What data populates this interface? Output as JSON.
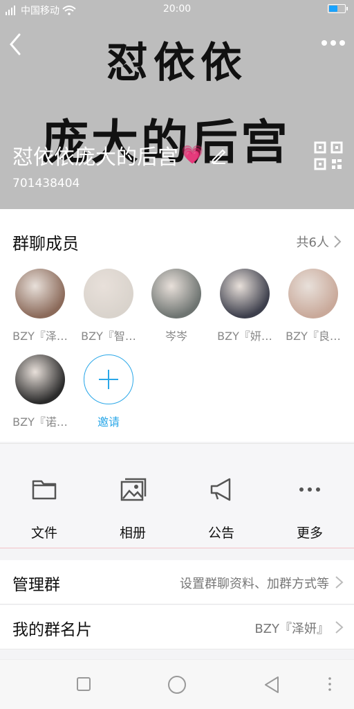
{
  "status_bar": {
    "carrier": "中国移动",
    "time": "20:00",
    "battery_level": 0.5
  },
  "header": {
    "art_line1": "怼依依",
    "art_line2": "庞大的后宫",
    "group_title": "怼依依庞大的后宫",
    "group_id": "701438404"
  },
  "members": {
    "title": "群聊成员",
    "count": "共6人",
    "list": [
      {
        "name": "BZY『泽…",
        "color": "#8b6a5a"
      },
      {
        "name": "BZY『智…",
        "color": "#d9d3cc"
      },
      {
        "name": "岑岑",
        "color": "#6e7471"
      },
      {
        "name": "BZY『妍…",
        "color": "#3d3f4c"
      },
      {
        "name": "BZY『良…",
        "color": "#c9a99a"
      },
      {
        "name": "BZY『诺…",
        "color": "#2b2b2b"
      }
    ],
    "invite_label": "邀请"
  },
  "actions": [
    {
      "label": "文件",
      "icon": "folder-icon"
    },
    {
      "label": "相册",
      "icon": "album-icon"
    },
    {
      "label": "公告",
      "icon": "megaphone-icon"
    },
    {
      "label": "更多",
      "icon": "more-dots-icon"
    }
  ],
  "rows": {
    "manage": {
      "title": "管理群",
      "value": "设置群聊资料、加群方式等"
    },
    "card": {
      "title": "我的群名片",
      "value": "BZY『泽妍』"
    }
  },
  "colors": {
    "accent": "#2aa7e8",
    "header_bg": "#bdbdbd"
  }
}
